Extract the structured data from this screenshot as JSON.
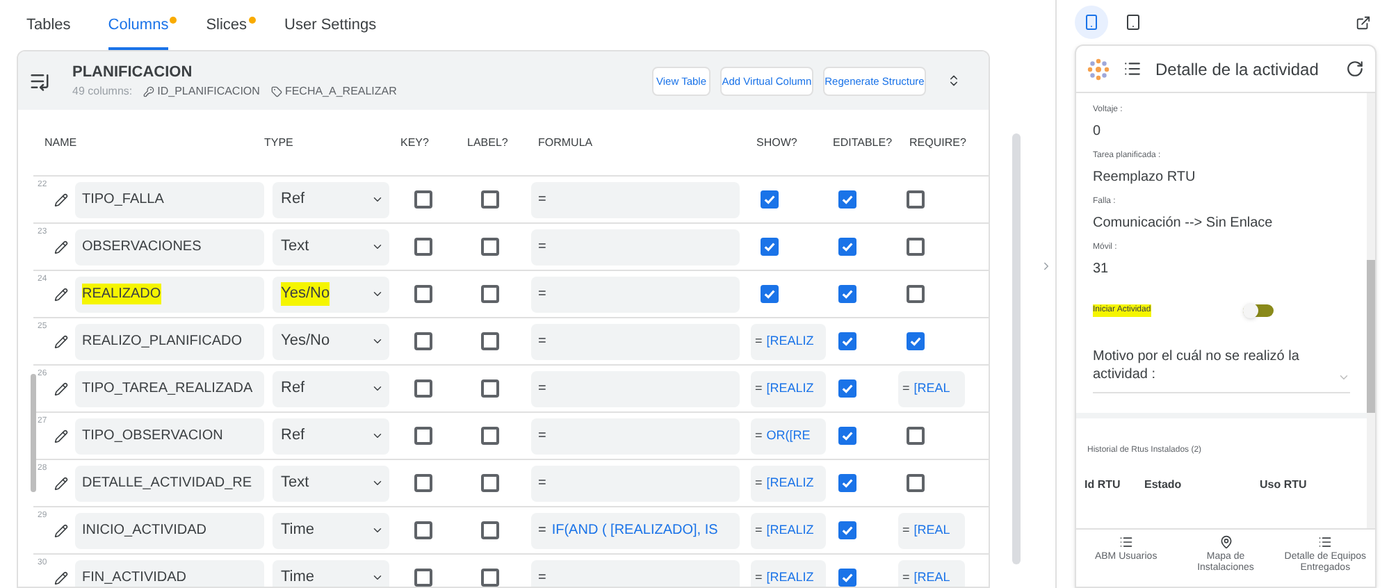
{
  "tabs": [
    {
      "label": "Tables",
      "selected": false,
      "dot": false
    },
    {
      "label": "Columns",
      "selected": true,
      "dot": true
    },
    {
      "label": "Slices",
      "selected": false,
      "dot": true
    },
    {
      "label": "User Settings",
      "selected": false,
      "dot": false
    }
  ],
  "table_card": {
    "title": "PLANIFICACION",
    "count": "49 columns:",
    "key_column": "ID_PLANIFICACION",
    "label_column": "FECHA_A_REALIZAR",
    "buttons": [
      "View Table",
      "Add Virtual Column",
      "Regenerate Structure"
    ]
  },
  "columns": [
    "NAME",
    "TYPE",
    "KEY?",
    "LABEL?",
    "FORMULA",
    "SHOW?",
    "EDITABLE?",
    "REQUIRE?"
  ],
  "rows": [
    {
      "num": "22",
      "name": "TIPO_FALLA",
      "type": "Ref",
      "highlighted": false,
      "key": false,
      "label": false,
      "formula": {
        "prefix": "="
      },
      "show": {
        "kind": "checkbox",
        "checked": true
      },
      "editable": true,
      "require": {
        "kind": "checkbox",
        "checked": false
      }
    },
    {
      "num": "23",
      "name": "OBSERVACIONES",
      "type": "Text",
      "highlighted": false,
      "key": false,
      "label": false,
      "formula": {
        "prefix": "="
      },
      "show": {
        "kind": "checkbox",
        "checked": true
      },
      "editable": true,
      "require": {
        "kind": "checkbox",
        "checked": false
      }
    },
    {
      "num": "24",
      "name": "REALIZADO",
      "type": "Yes/No",
      "highlighted": true,
      "key": false,
      "label": false,
      "formula": {
        "prefix": "="
      },
      "show": {
        "kind": "checkbox",
        "checked": true
      },
      "editable": true,
      "require": {
        "kind": "checkbox",
        "checked": false
      }
    },
    {
      "num": "25",
      "name": "REALIZO_PLANIFICADO",
      "type": "Yes/No",
      "highlighted": false,
      "key": false,
      "label": false,
      "formula": {
        "prefix": "="
      },
      "show": {
        "kind": "formula",
        "prefix": "=",
        "text": "[REALIZ"
      },
      "editable": true,
      "require": {
        "kind": "checkbox",
        "checked": true
      }
    },
    {
      "num": "26",
      "name": "TIPO_TAREA_REALIZADA",
      "type": "Ref",
      "highlighted": false,
      "key": false,
      "label": false,
      "formula": {
        "prefix": "="
      },
      "show": {
        "kind": "formula",
        "prefix": "=",
        "text": "[REALIZ"
      },
      "editable": true,
      "require": {
        "kind": "formula",
        "prefix": "=",
        "text": "[REAL"
      }
    },
    {
      "num": "27",
      "name": "TIPO_OBSERVACION",
      "type": "Ref",
      "highlighted": false,
      "key": false,
      "label": false,
      "formula": {
        "prefix": "="
      },
      "show": {
        "kind": "formula",
        "prefix": "=",
        "text": "OR([RE"
      },
      "editable": true,
      "require": {
        "kind": "checkbox",
        "checked": false
      }
    },
    {
      "num": "28",
      "name": "DETALLE_ACTIVIDAD_RE",
      "type": "Text",
      "highlighted": false,
      "key": false,
      "label": false,
      "formula": {
        "prefix": "="
      },
      "show": {
        "kind": "formula",
        "prefix": "=",
        "text": "[REALIZ"
      },
      "editable": true,
      "require": {
        "kind": "checkbox",
        "checked": false
      }
    },
    {
      "num": "29",
      "name": "INICIO_ACTIVIDAD",
      "type": "Time",
      "highlighted": false,
      "key": false,
      "label": false,
      "formula": {
        "prefix": "=",
        "text": "IF(AND ( [REALIZADO],  IS"
      },
      "show": {
        "kind": "formula",
        "prefix": "=",
        "text": "[REALIZ"
      },
      "editable": true,
      "require": {
        "kind": "formula",
        "prefix": "=",
        "text": "[REAL"
      }
    },
    {
      "num": "30",
      "name": "FIN_ACTIVIDAD",
      "type": "Time",
      "highlighted": false,
      "key": false,
      "label": false,
      "formula": {
        "prefix": "="
      },
      "show": {
        "kind": "formula",
        "prefix": "=",
        "text": "[REALIZ"
      },
      "editable": true,
      "require": {
        "kind": "formula",
        "prefix": "=",
        "text": "[REAL"
      }
    }
  ],
  "preview": {
    "device_modes": [
      {
        "kind": "phone",
        "selected": true
      },
      {
        "kind": "tablet",
        "selected": false
      }
    ],
    "title": "Detalle de la actividad",
    "fields": [
      {
        "label": "Voltaje :",
        "value": "0"
      },
      {
        "label": "Tarea planificada :",
        "value": "Reemplazo RTU"
      },
      {
        "label": "Falla :",
        "value": "Comunicación --> Sin Enlace"
      },
      {
        "label": "Móvil :",
        "value": "31"
      }
    ],
    "toggle": {
      "label": "Iniciar Actividad",
      "on": false,
      "highlighted": true
    },
    "dropdown": {
      "label": "Motivo por el cuál no se realizó la actividad :"
    },
    "history": {
      "title": "Historial de Rtus Instalados (2)",
      "columns": [
        "Id RTU",
        "Estado",
        "Uso RTU"
      ]
    },
    "nav": [
      {
        "kind": "list",
        "label": "ABM Usuarios"
      },
      {
        "kind": "pin",
        "label": "Mapa de Instalaciones"
      },
      {
        "kind": "list",
        "label": "Detalle de Equipos Entregados"
      }
    ]
  }
}
